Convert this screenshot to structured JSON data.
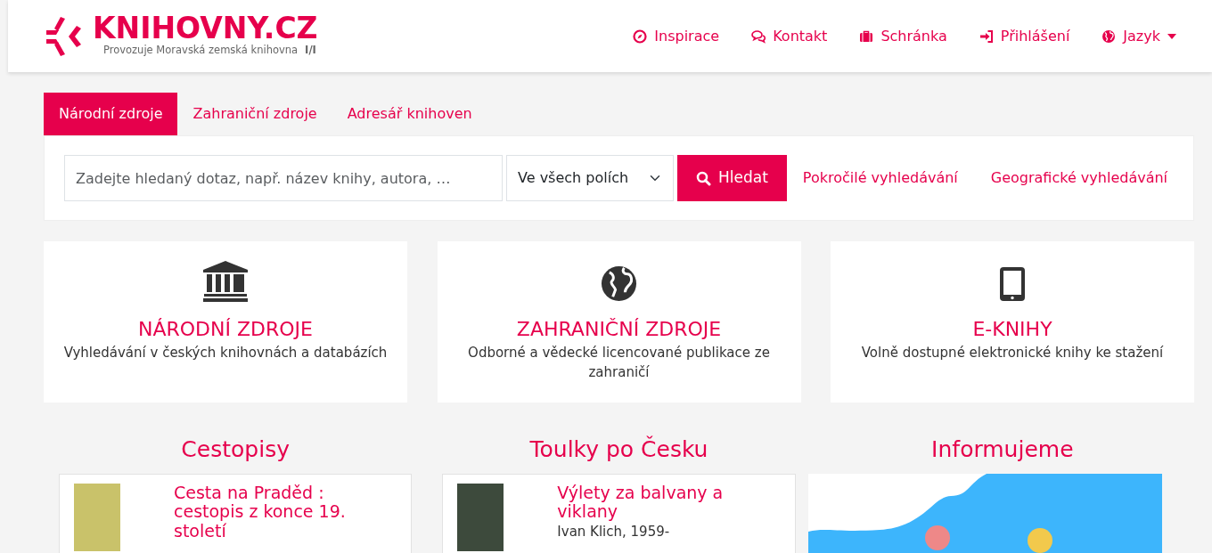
{
  "header": {
    "logo": {
      "title": "KNIHOVNY.CZ",
      "subtitle": "Provozuje Moravská zemská knihovna",
      "mark": "I/I"
    },
    "nav": [
      {
        "label": "Inspirace",
        "dropdown": false
      },
      {
        "label": "Kontakt",
        "dropdown": false
      },
      {
        "label": "Schránka",
        "dropdown": false
      },
      {
        "label": "Přihlášení",
        "dropdown": false
      },
      {
        "label": "Jazyk",
        "dropdown": true
      }
    ]
  },
  "search": {
    "tabs": [
      {
        "label": "Národní zdroje",
        "selected": true
      },
      {
        "label": "Zahraniční zdroje",
        "selected": false
      },
      {
        "label": "Adresář knihoven",
        "selected": false
      }
    ],
    "placeholder": "Zadejte hledaný dotaz, např. název knihy, autora, …",
    "scope": "Ve všech polích",
    "button": "Hledat",
    "links": [
      "Pokročilé vyhledávání",
      "Geografické vyhledávání"
    ]
  },
  "categories": [
    {
      "title": "NÁRODNÍ ZDROJE",
      "description": "Vyhledávání v českých knihovnách a databázích"
    },
    {
      "title": "ZAHRANIČNÍ ZDROJE",
      "description": "Odborné a vědecké licencované publikace ze zahraničí"
    },
    {
      "title": "E-KNIHY",
      "description": "Volně dostupné elektronické knihy ke stažení"
    }
  ],
  "sections": [
    {
      "title": "Cestopisy",
      "kind": "book",
      "item": {
        "title": "Cesta na Praděd : cestopis z konce 19. století"
      }
    },
    {
      "title": "Toulky po Česku",
      "kind": "book",
      "item": {
        "title": "Výlety za balvany a viklany",
        "author": "Ivan Klich, 1959-"
      }
    },
    {
      "title": "Informujeme",
      "kind": "image"
    }
  ]
}
